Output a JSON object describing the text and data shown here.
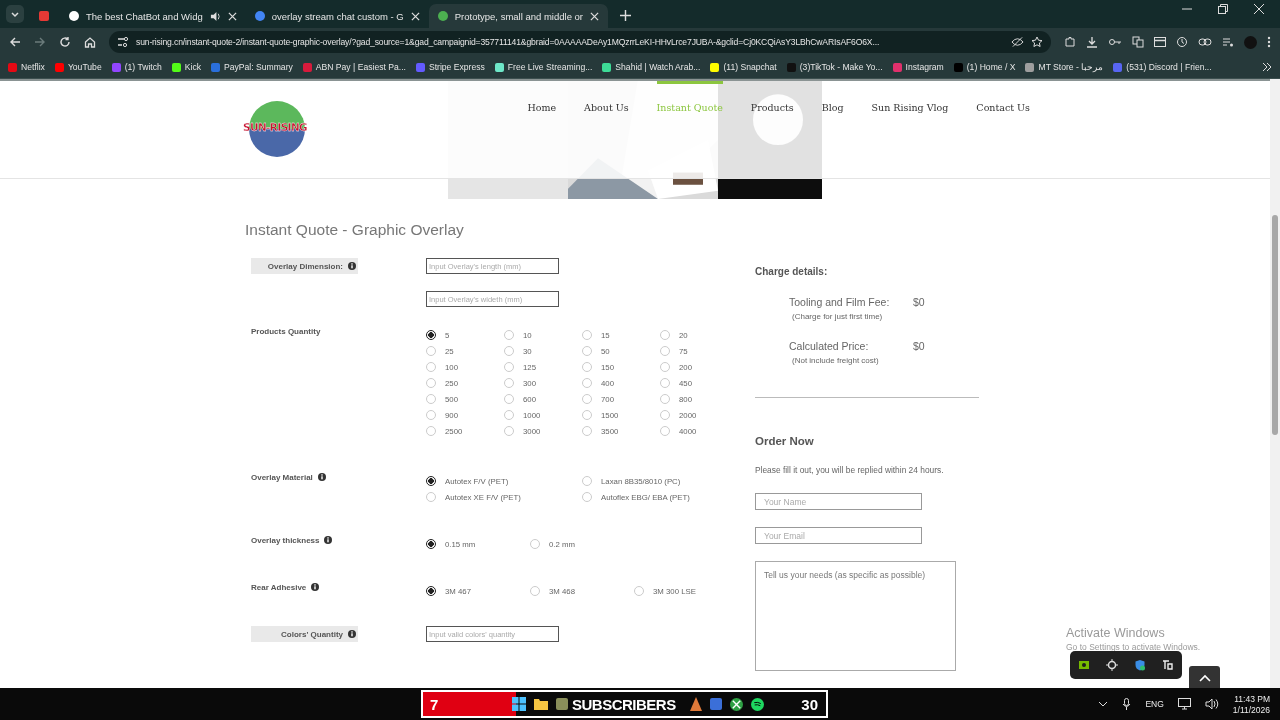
{
  "browser": {
    "tabs": [
      {
        "kind": "pinned",
        "selected": false,
        "color": "#e53935"
      },
      {
        "kind": "normal",
        "title": "The best ChatBot and Widg",
        "audio": true,
        "selected": false,
        "color": "#ffffff"
      },
      {
        "kind": "normal",
        "title": "overlay stream chat custom - G",
        "audio": false,
        "selected": false,
        "color": "#4285f4"
      },
      {
        "kind": "normal",
        "title": "Prototype, small and middle or",
        "audio": false,
        "selected": true,
        "color": "#4caf50"
      }
    ],
    "url": "sun-rising.cn/instant-quote-2/instant-quote-graphic-overlay/?gad_source=1&gad_campaignid=357711141&gbraid=0AAAAADeAy1MQzrrLeKI-HHvLrce7JUBA-&gclid=Cj0KCQiAsY3LBhCwARIsAF6O6X...",
    "forward_disabled": true,
    "bookmarks": [
      {
        "label": "Netflix",
        "color": "#e50914"
      },
      {
        "label": "YouTube",
        "color": "#ff0000"
      },
      {
        "label": "(1) Twitch",
        "color": "#9146ff"
      },
      {
        "label": "Kick",
        "color": "#53fc18"
      },
      {
        "label": "PayPal: Summary",
        "color": "#2a6fdb"
      },
      {
        "label": "ABN Pay | Easiest Pa...",
        "color": "#d81b3c"
      },
      {
        "label": "Stripe Express",
        "color": "#635bff"
      },
      {
        "label": "Free Live Streaming...",
        "color": "#6ee7c8"
      },
      {
        "label": "Shahid | Watch Arab...",
        "color": "#3ddc97"
      },
      {
        "label": "(11) Snapchat",
        "color": "#fffc00"
      },
      {
        "label": "(3)TikTok - Make Yo...",
        "color": "#111111"
      },
      {
        "label": "Instagram",
        "color": "#e1306c"
      },
      {
        "label": "(1) Home / X",
        "color": "#000000"
      },
      {
        "label": "MT Store - مرحبا",
        "color": "#9e9e9e"
      },
      {
        "label": "(531) Discord | Frien...",
        "color": "#5865f2"
      }
    ]
  },
  "site": {
    "logo": "SUN-RISING",
    "nav": [
      {
        "label": "Home",
        "selected": false
      },
      {
        "label": "About Us",
        "selected": false
      },
      {
        "label": "Instant Quote",
        "selected": true
      },
      {
        "label": "Products",
        "selected": false
      },
      {
        "label": "Blog",
        "selected": false
      },
      {
        "label": "Sun Rising Vlog",
        "selected": false
      },
      {
        "label": "Contact Us",
        "selected": false
      }
    ],
    "heading": "Instant Quote - Graphic Overlay",
    "form": [
      {
        "kind": "inputs",
        "label": "Overlay Dimension:",
        "info": true,
        "shaded": true,
        "placeholders": [
          "Input Overlay's length (mm)",
          "Input Overlay's wideth (mm)"
        ]
      },
      {
        "kind": "grid",
        "label": "Products Quantity",
        "info": false,
        "shaded": false,
        "options": [
          {
            "label": "5",
            "selected": true
          },
          {
            "label": "10",
            "selected": false
          },
          {
            "label": "15",
            "selected": false
          },
          {
            "label": "20",
            "selected": false
          },
          {
            "label": "25",
            "selected": false
          },
          {
            "label": "30",
            "selected": false
          },
          {
            "label": "50",
            "selected": false
          },
          {
            "label": "75",
            "selected": false
          },
          {
            "label": "100",
            "selected": false
          },
          {
            "label": "125",
            "selected": false
          },
          {
            "label": "150",
            "selected": false
          },
          {
            "label": "200",
            "selected": false
          },
          {
            "label": "250",
            "selected": false
          },
          {
            "label": "300",
            "selected": false
          },
          {
            "label": "400",
            "selected": false
          },
          {
            "label": "450",
            "selected": false
          },
          {
            "label": "500",
            "selected": false
          },
          {
            "label": "600",
            "selected": false
          },
          {
            "label": "700",
            "selected": false
          },
          {
            "label": "800",
            "selected": false
          },
          {
            "label": "900",
            "selected": false
          },
          {
            "label": "1000",
            "selected": false
          },
          {
            "label": "1500",
            "selected": false
          },
          {
            "label": "2000",
            "selected": false
          },
          {
            "label": "2500",
            "selected": false
          },
          {
            "label": "3000",
            "selected": false
          },
          {
            "label": "3500",
            "selected": false
          },
          {
            "label": "4000",
            "selected": false
          }
        ]
      },
      {
        "kind": "pairs",
        "label": "Overlay Material",
        "info": true,
        "shaded": false,
        "options": [
          {
            "label": "Autotex F/V (PET)",
            "selected": true
          },
          {
            "label": "Laxan 8B35/8010 (PC)",
            "selected": false
          },
          {
            "label": "Autotex XE F/V (PET)",
            "selected": false
          },
          {
            "label": "Autoflex EBG/ EBA (PET)",
            "selected": false
          }
        ]
      },
      {
        "kind": "inline",
        "label": "Overlay thickness",
        "info": true,
        "shaded": false,
        "options": [
          {
            "label": "0.15 mm",
            "selected": true
          },
          {
            "label": "0.2 mm",
            "selected": false
          }
        ]
      },
      {
        "kind": "inline",
        "label": "Rear Adhesive",
        "info": true,
        "shaded": false,
        "options": [
          {
            "label": "3M 467",
            "selected": true
          },
          {
            "label": "3M 468",
            "selected": false
          },
          {
            "label": "3M 300 LSE",
            "selected": false
          }
        ]
      },
      {
        "kind": "inputs",
        "label": "Colors' Quantity",
        "info": true,
        "shaded": true,
        "placeholders": [
          "Input valid colors' quantity"
        ]
      }
    ],
    "charge": {
      "title": "Charge details:",
      "lines": [
        {
          "label": "Tooling and Film Fee:",
          "value": "$0",
          "note": "(Charge for just first time)"
        },
        {
          "label": "Calculated Price:",
          "value": "$0",
          "note": "(Not include freight cost)"
        }
      ]
    },
    "order": {
      "title": "Order Now",
      "text": "Please fill it out, you will be replied within 24 hours.",
      "name_placeholder": "Your Name",
      "email_placeholder": "Your Email",
      "needs_placeholder": "Tell us your needs (as specific as possible)"
    }
  },
  "activation": {
    "title": "Activate Windows",
    "text": "Go to Settings to activate Windows."
  },
  "taskbar": {
    "widget": {
      "count": "7",
      "label": "SUBSCRIBERS",
      "goal": "30",
      "level": 0.23
    },
    "language": "ENG",
    "time": "11:43 PM",
    "date": "1/11/2026"
  }
}
